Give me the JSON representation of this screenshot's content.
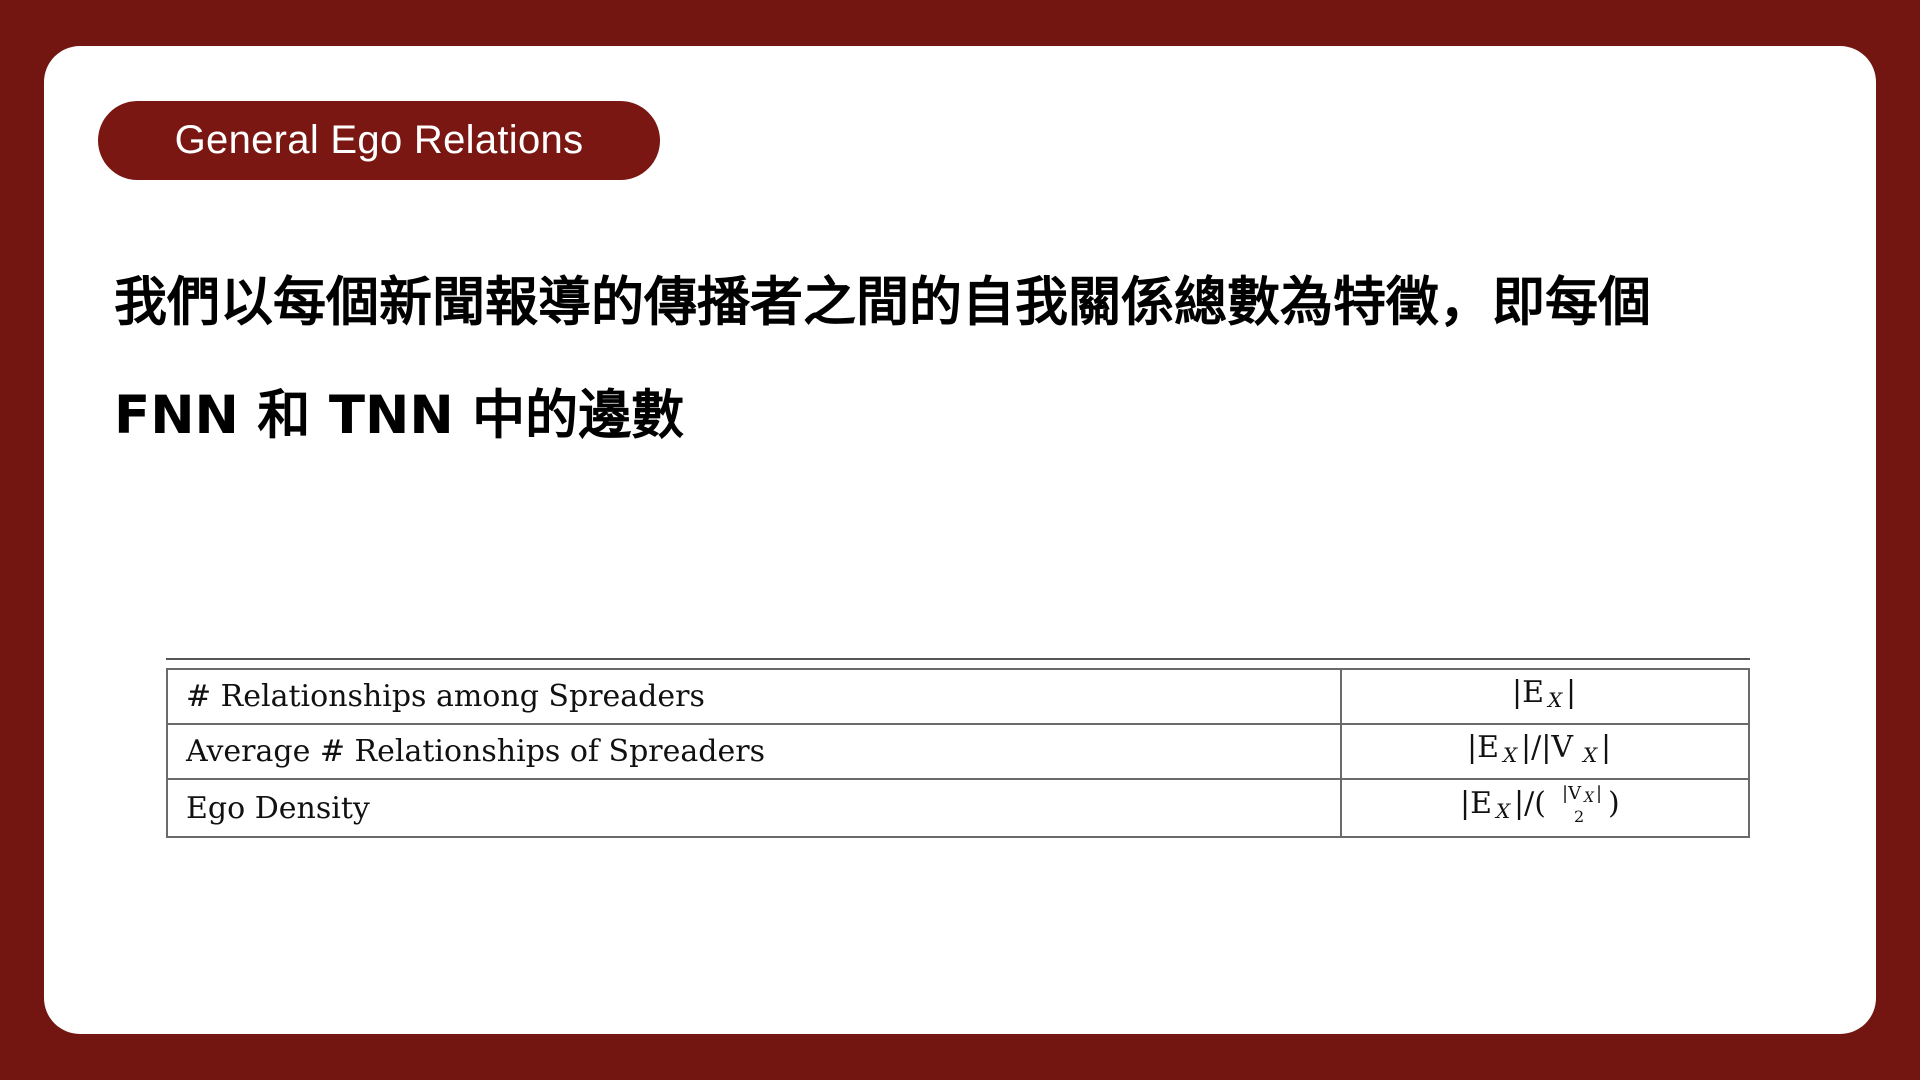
{
  "slide": {
    "title": "General Ego Relations",
    "body": "我們以每個新聞報導的傳播者之間的自我關係總數為特徵，即每個 FNN 和 TNN 中的邊數"
  },
  "table": {
    "rows": [
      {
        "label": "# Relationships among Spreaders",
        "formula": "|E_X|"
      },
      {
        "label": "Average # Relationships of Spreaders",
        "formula": "|E_X|/|V_X|"
      },
      {
        "label": "Ego Density",
        "formula": "|E_X|/(|V_X| choose 2)"
      }
    ]
  },
  "colors": {
    "background": "#731510",
    "accent": "#7a1712",
    "card": "#ffffff"
  }
}
